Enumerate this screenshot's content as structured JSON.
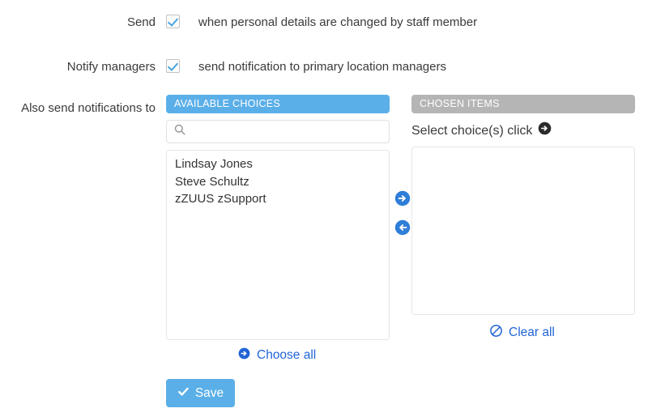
{
  "colors": {
    "accent_blue": "#5bafe8",
    "link_blue": "#1f64d6",
    "arrow_blue": "#2f7ed8",
    "header_gray": "#b5b5b5",
    "text": "#3a3a3a"
  },
  "rows": {
    "send": {
      "label": "Send",
      "checked": true,
      "description": "when personal details are changed by staff member"
    },
    "notify_managers": {
      "label": "Notify managers",
      "checked": true,
      "description": "send notification to primary location managers"
    },
    "also_send": {
      "label": "Also send notifications to"
    }
  },
  "dual_list": {
    "available": {
      "header": "AVAILABLE CHOICES",
      "search_value": "",
      "search_placeholder": "",
      "items": [
        "Lindsay Jones",
        "Steve Schultz",
        "zZUUS zSupport"
      ],
      "choose_all_label": "Choose all"
    },
    "chosen": {
      "header": "CHOSEN ITEMS",
      "hint": "Select choice(s) click",
      "items": [],
      "clear_all_label": "Clear all"
    },
    "transfer": {
      "move_right_title": "Move right",
      "move_left_title": "Move left"
    }
  },
  "footer": {
    "save_label": "Save"
  }
}
